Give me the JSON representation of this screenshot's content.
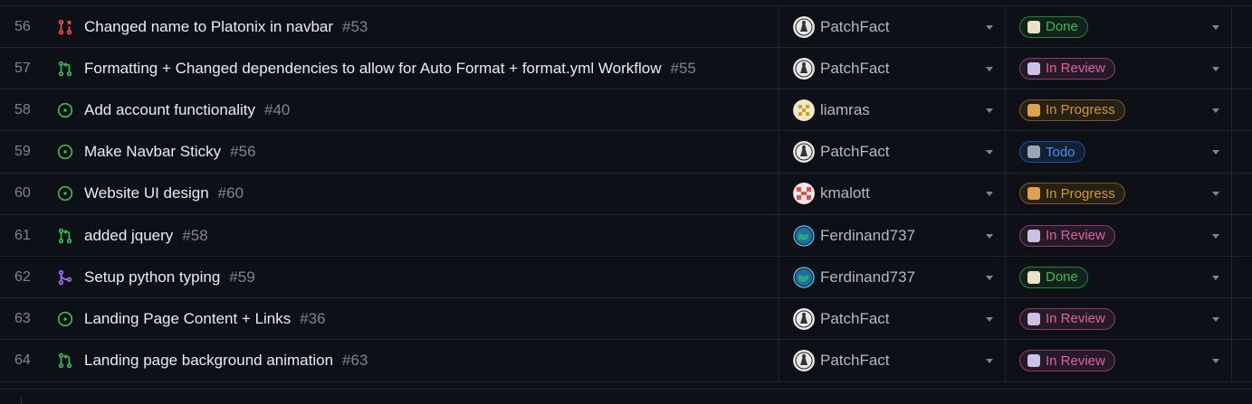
{
  "rows": [
    {
      "num": "56",
      "status_icon": "pr-closed-icon",
      "title": "Changed name to Platonix in navbar",
      "ref": "#53",
      "assignee": "PatchFact",
      "avatar": "patchfact",
      "status": "Done",
      "status_type": "done"
    },
    {
      "num": "57",
      "status_icon": "pr-open-icon",
      "title": "Formatting + Changed dependencies to allow for Auto Format + format.yml Workflow",
      "ref": "#55",
      "assignee": "PatchFact",
      "avatar": "patchfact",
      "status": "In Review",
      "status_type": "review"
    },
    {
      "num": "58",
      "status_icon": "issue-open-icon",
      "title": "Add account functionality",
      "ref": "#40",
      "assignee": "liamras",
      "avatar": "liamras",
      "status": "In Progress",
      "status_type": "progress"
    },
    {
      "num": "59",
      "status_icon": "issue-open-icon",
      "title": "Make Navbar Sticky",
      "ref": "#56",
      "assignee": "PatchFact",
      "avatar": "patchfact",
      "status": "Todo",
      "status_type": "todo"
    },
    {
      "num": "60",
      "status_icon": "issue-open-icon",
      "title": "Website UI design",
      "ref": "#60",
      "assignee": "kmalott",
      "avatar": "kmalott",
      "status": "In Progress",
      "status_type": "progress"
    },
    {
      "num": "61",
      "status_icon": "pr-open-icon",
      "title": "added jquery",
      "ref": "#58",
      "assignee": "Ferdinand737",
      "avatar": "ferdinand",
      "status": "In Review",
      "status_type": "review"
    },
    {
      "num": "62",
      "status_icon": "pr-merged-icon",
      "title": "Setup python typing",
      "ref": "#59",
      "assignee": "Ferdinand737",
      "avatar": "ferdinand",
      "status": "Done",
      "status_type": "done"
    },
    {
      "num": "63",
      "status_icon": "issue-open-icon",
      "title": "Landing Page Content + Links",
      "ref": "#36",
      "assignee": "PatchFact",
      "avatar": "patchfact",
      "status": "In Review",
      "status_type": "review"
    },
    {
      "num": "64",
      "status_icon": "pr-open-icon",
      "title": "Landing page background animation",
      "ref": "#63",
      "assignee": "PatchFact",
      "avatar": "patchfact",
      "status": "In Review",
      "status_type": "review"
    }
  ],
  "colors": {
    "open": "#3fb950",
    "closed": "#f85149",
    "merged": "#a371f7"
  }
}
